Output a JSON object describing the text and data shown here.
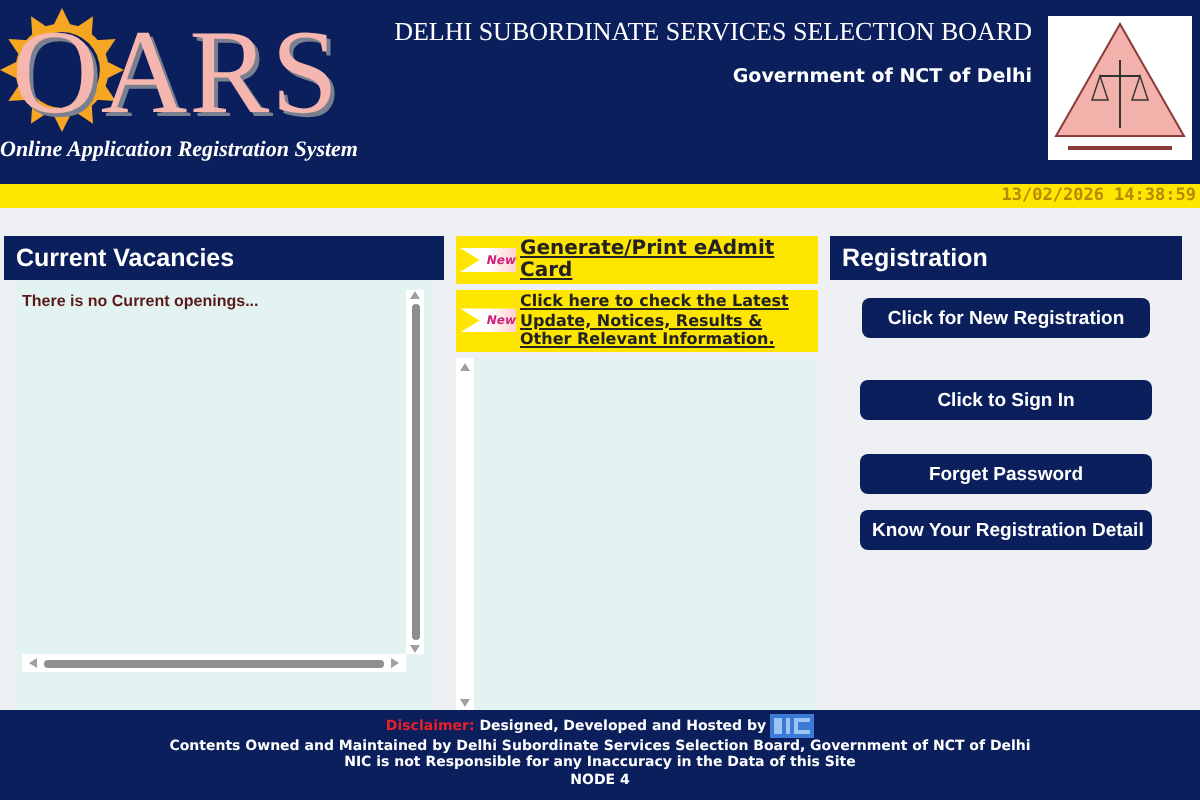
{
  "header": {
    "logo_text": "OARS",
    "tagline": "Online Application Registration System",
    "title": "DELHI SUBORDINATE SERVICES SELECTION BOARD",
    "subtitle": "Government of NCT of Delhi"
  },
  "date_bar": {
    "datetime": "13/02/2026 14:38:59"
  },
  "vacancies": {
    "title": "Current Vacancies",
    "message": "There is no Current openings..."
  },
  "notices": [
    {
      "badge": "New",
      "text": "Generate/Print eAdmit Card",
      "large": true
    },
    {
      "badge": "New",
      "text": "Click here to check the Latest Update, Notices, Results & Other Relevant Information.",
      "large": false
    }
  ],
  "registration": {
    "title": "Registration",
    "buttons": [
      "Click for New Registration",
      "Click to Sign In",
      "Forget Password",
      "Know Your Registration Detail"
    ]
  },
  "footer": {
    "disclaimer_label": "Disclaimer:",
    "disclaimer_text": "Designed, Developed and Hosted by",
    "lines": [
      "Contents Owned and Maintained by Delhi Subordinate Services Selection Board, Government of NCT of Delhi",
      "NIC is not Responsible for any Inaccuracy in the Data of this Site",
      "NODE 4"
    ]
  }
}
